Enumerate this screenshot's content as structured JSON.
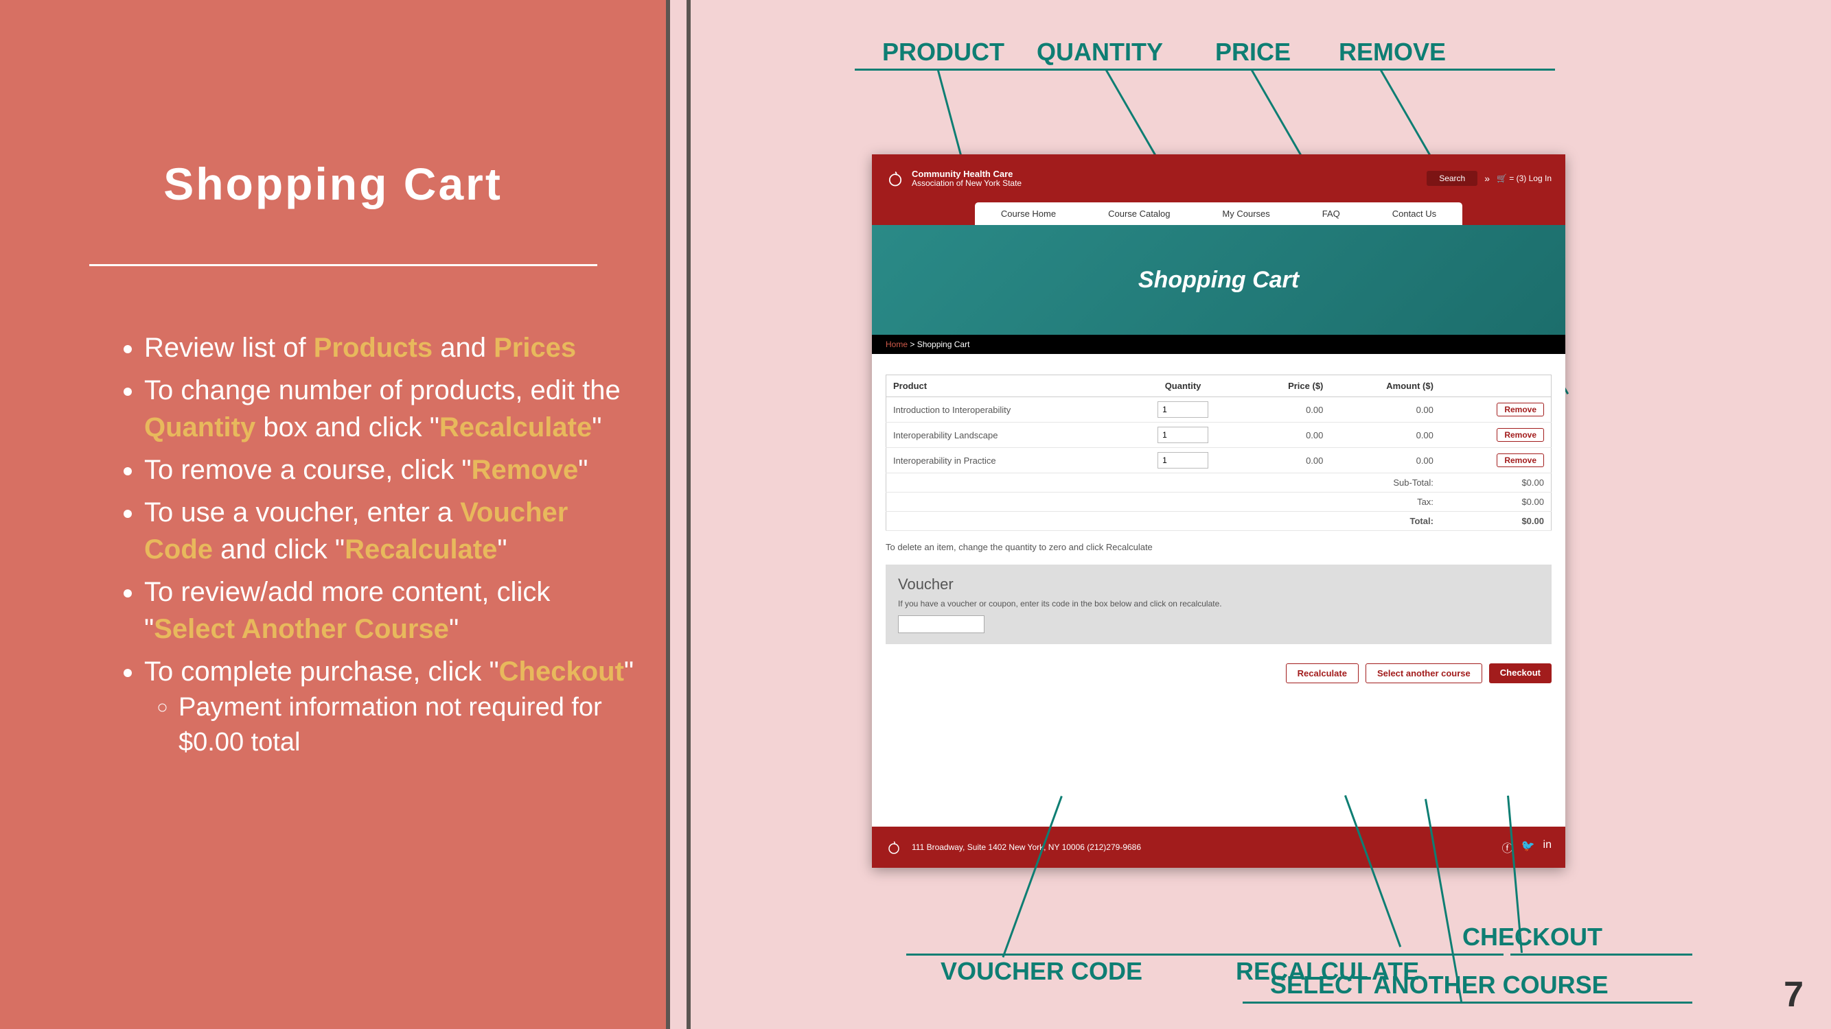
{
  "left": {
    "title": "Shopping Cart",
    "b1a": "Review list of ",
    "b1h1": "Products",
    "b1b": " and ",
    "b1h2": "Prices",
    "b2a": "To change number of products, edit the ",
    "b2h": "Quantity",
    "b2b": " box and click \"",
    "b2h2": "Recalculate",
    "b2c": "\"",
    "b3a": "To remove a course, click \"",
    "b3h": "Remove",
    "b3b": "\"",
    "b4a": "To use a voucher, enter a ",
    "b4h": "Voucher Code",
    "b4b": " and click \"",
    "b4h2": "Recalculate",
    "b4c": "\"",
    "b5a": "To review/add more content, click \"",
    "b5h": "Select Another Course",
    "b5b": "\"",
    "b6a": "To complete purchase, click \"",
    "b6h": "Checkout",
    "b6b": "\"",
    "b6sub": "Payment information not required for $0.00 total"
  },
  "topLabels": {
    "product": "PRODUCT",
    "quantity": "QUANTITY",
    "price": "PRICE",
    "remove": "REMOVE"
  },
  "bottomLabels": {
    "voucher": "VOUCHER CODE",
    "recalc": "RECALCULATE",
    "checkout": "CHECKOUT",
    "select": "SELECT ANOTHER COURSE"
  },
  "pageNum": "7",
  "shot": {
    "brand1": "Community Health Care",
    "brand2": "Association of New York State",
    "search": "Search",
    "cartLogin": "🛒 = (3)  Log In",
    "nav": [
      "Course Home",
      "Course Catalog",
      "My Courses",
      "FAQ",
      "Contact Us"
    ],
    "hero": "Shopping Cart",
    "crumbHome": "Home",
    "crumbSep": "  >  Shopping Cart",
    "table": {
      "hProduct": "Product",
      "hQty": "Quantity",
      "hPrice": "Price ($)",
      "hAmount": "Amount ($)",
      "rows": [
        {
          "p": "Introduction to Interoperability",
          "q": "1",
          "pr": "0.00",
          "am": "0.00"
        },
        {
          "p": "Interoperability Landscape",
          "q": "1",
          "pr": "0.00",
          "am": "0.00"
        },
        {
          "p": "Interoperability in Practice",
          "q": "1",
          "pr": "0.00",
          "am": "0.00"
        }
      ],
      "subLbl": "Sub-Total:",
      "subV": "$0.00",
      "taxLbl": "Tax:",
      "taxV": "$0.00",
      "totLbl": "Total:",
      "totV": "$0.00",
      "removeBtn": "Remove"
    },
    "delNote": "To delete an item, change the quantity to zero and click Recalculate",
    "voucher": {
      "title": "Voucher",
      "desc": "If you have a voucher or coupon, enter its code in the box below and click on recalculate."
    },
    "btnRecalc": "Recalculate",
    "btnSelect": "Select another course",
    "btnCheckout": "Checkout",
    "footerAddr": "111 Broadway, Suite 1402   New York, NY 10006   (212)279-9686"
  }
}
